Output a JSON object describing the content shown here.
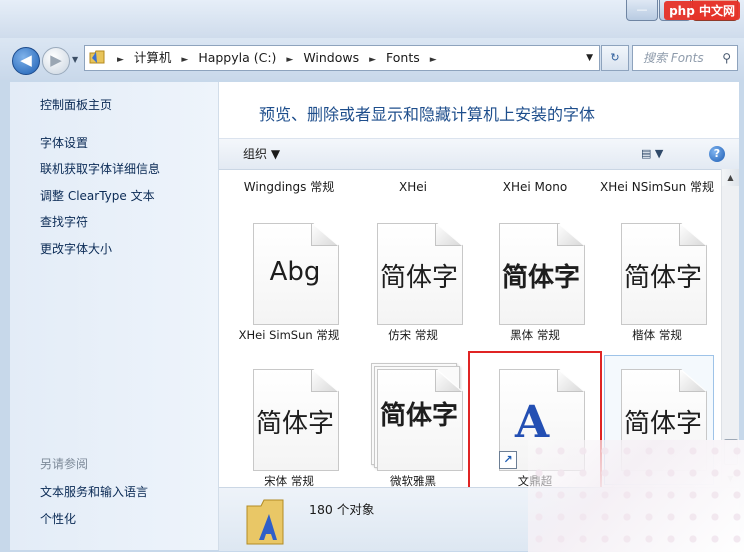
{
  "window": {
    "brand_badge": "php 中文网",
    "minimize_glyph": "—",
    "maximize_glyph": "□",
    "close_glyph": "✕"
  },
  "nav": {
    "back_glyph": "◀",
    "forward_glyph": "▶",
    "dropdown_glyph": "▼"
  },
  "address": {
    "crumbs": [
      "计算机",
      "Happyla (C:)",
      "Windows",
      "Fonts"
    ],
    "separator": "►",
    "dropdown_glyph": "▼",
    "refresh_glyph": "↻"
  },
  "search": {
    "placeholder": "搜索 Fonts",
    "icon": "search-icon",
    "icon_glyph": "⚲"
  },
  "sidebar": {
    "home_link": "控制面板主页",
    "links": [
      "字体设置",
      "联机获取字体详细信息",
      "调整 ClearType 文本",
      "查找字符",
      "更改字体大小"
    ],
    "see_also_heading": "另请参阅",
    "see_also_links": [
      "文本服务和输入语言",
      "个性化"
    ]
  },
  "content": {
    "title": "预览、删除或者显示和隐藏计算机上安装的字体",
    "organize_label": "组织 ▼",
    "view_glyph": "▤ ▼",
    "help_glyph": "?"
  },
  "fonts_top_row": [
    "Wingdings 常规",
    "XHei",
    "XHei Mono",
    "XHei NSimSun 常规"
  ],
  "fonts_row1": [
    {
      "sample": "Abg",
      "label": "XHei SimSun 常规"
    },
    {
      "sample": "简体字",
      "label": "仿宋 常规"
    },
    {
      "sample": "简体字",
      "label": "黑体 常规"
    },
    {
      "sample": "简体字",
      "label": "楷体 常规"
    }
  ],
  "fonts_row2": [
    {
      "sample": "简体字",
      "label": "宋体 常规"
    },
    {
      "sample": "简体字",
      "label": "微软雅黑"
    },
    {
      "sample": "A",
      "label": "文鼎超"
    },
    {
      "sample": "简体字",
      "label": ""
    }
  ],
  "scrollbar": {
    "up_glyph": "▲",
    "down_glyph": "▼"
  },
  "details": {
    "count": "180 个对象"
  },
  "colors": {
    "accent": "#1e4e8c",
    "highlight_box": "#e02424",
    "link": "#0a2a55"
  }
}
